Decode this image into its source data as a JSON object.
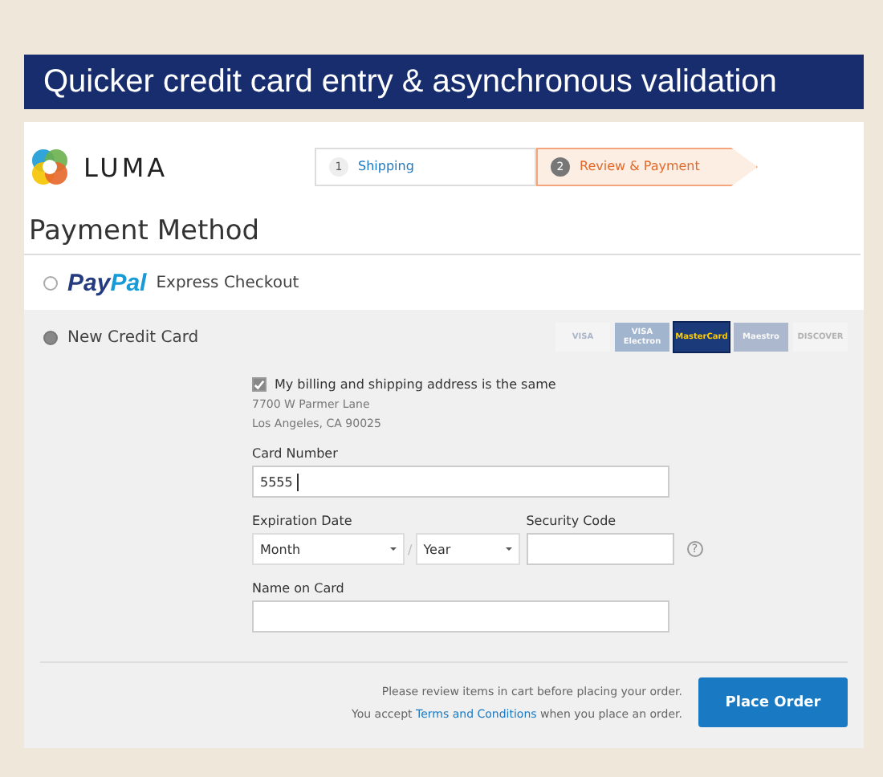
{
  "slide_title": "Quicker credit card entry & asynchronous validation",
  "logo": {
    "name": "LUMA"
  },
  "steps": [
    {
      "number": "1",
      "label": "Shipping",
      "selected": false
    },
    {
      "number": "2",
      "label": "Review & Payment",
      "selected": true
    }
  ],
  "heading": "Payment Method",
  "methods": [
    {
      "kind": "paypal",
      "logo_first": "Pay",
      "logo_second": "Pal",
      "label": "Express Checkout",
      "selected": false
    },
    {
      "kind": "card",
      "label": "New Credit Card",
      "selected": true
    }
  ],
  "card_types": [
    {
      "label": "VISA",
      "active": false
    },
    {
      "label": "VISA Electron",
      "active": false
    },
    {
      "label": "MasterCard",
      "active": true
    },
    {
      "label": "Maestro",
      "active": false
    },
    {
      "label": "DISCOVER",
      "active": false
    }
  ],
  "same_address": {
    "label": "My billing and shipping address is the same",
    "checked": true
  },
  "address_lines": [
    "7700 W Parmer Lane",
    "Los Angeles, CA 90025"
  ],
  "card_number": {
    "label": "Card Number",
    "value": "5555"
  },
  "expiration": {
    "label": "Expiration Date",
    "month": "Month",
    "separator": "/",
    "year": "Year"
  },
  "security_code": {
    "label": "Security Code",
    "help": "?"
  },
  "name_on_card": {
    "label": "Name on Card"
  },
  "notice": "Please review items in cart before placing your order.",
  "terms": {
    "before": "You accept ",
    "link": "Terms and Conditions",
    "after": " when you place an order."
  },
  "place_order": "Place Order"
}
